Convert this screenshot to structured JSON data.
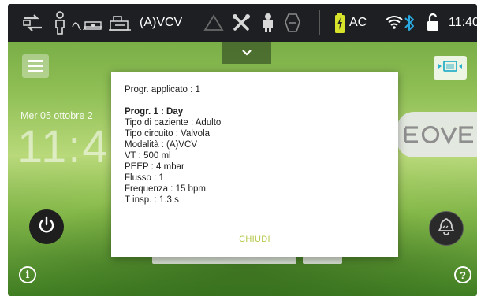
{
  "status_bar": {
    "mode": "(A)VCV",
    "power_source": "AC",
    "time": "11:40"
  },
  "home": {
    "date": "Mer 05 ottobre 2",
    "clock": "11:4",
    "brand": "EOVE"
  },
  "dialog": {
    "applied_program": "Progr. applicato : 1",
    "program_title": "Progr. 1 : Day",
    "details": [
      "Tipo di paziente : Adulto",
      "Tipo circuito : Valvola",
      "Modalità : (A)VCV",
      "VT : 500 ml",
      "PEEP : 4 mbar",
      "Flusso : 1",
      "Frequenza : 15 bpm",
      "T insp. : 1.3 s"
    ],
    "close_label": "CHIUDI"
  },
  "colors": {
    "status_bar_bg": "#1d1f22",
    "accent_close": "#b6c74a",
    "battery_fill": "#d7e22a",
    "bluetooth": "#2aa8e0"
  },
  "icons": [
    "ventilation-transfer-icon",
    "patient-adult-icon",
    "circuit-valve-icon",
    "humidifier-icon",
    "alarm-triangle-icon",
    "tools-icon",
    "patient-icon",
    "mask-icon",
    "battery-icon",
    "wifi-icon",
    "bluetooth-icon",
    "lock-icon",
    "menu-icon",
    "screen-icon",
    "power-icon",
    "alarm-bell-icon",
    "info-icon",
    "help-icon",
    "chevron-down-icon"
  ]
}
